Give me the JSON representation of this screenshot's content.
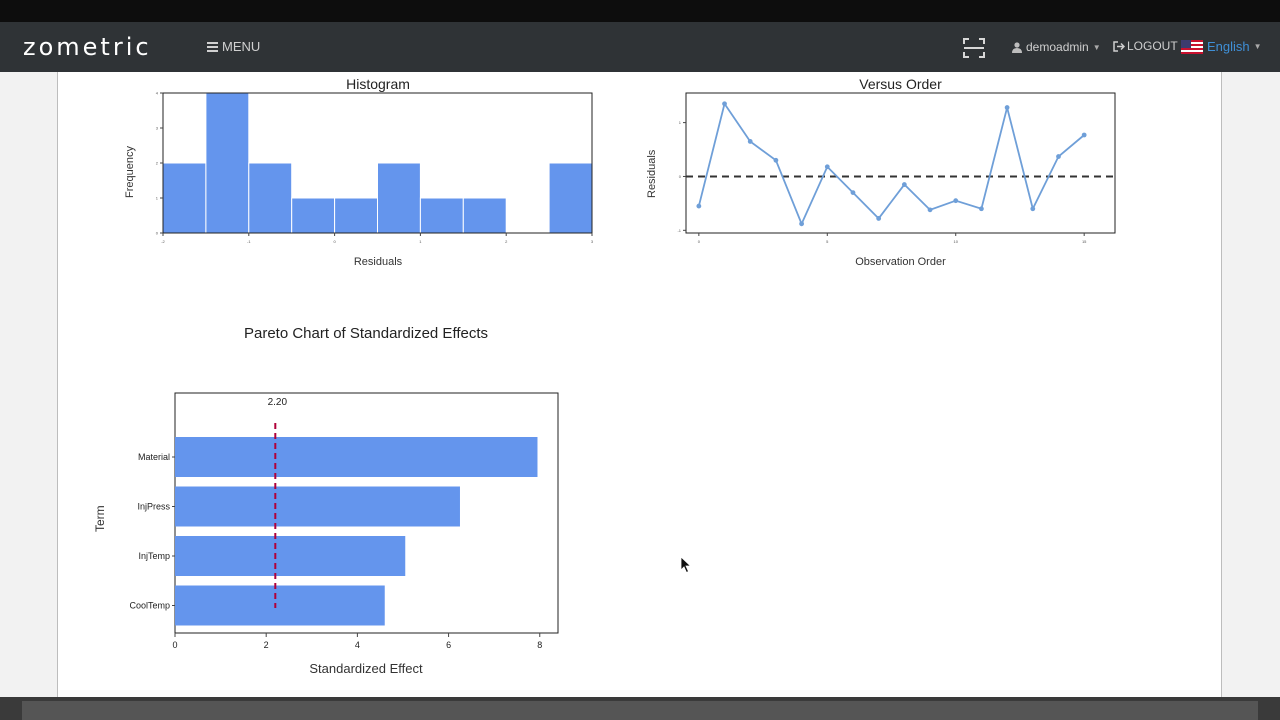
{
  "navbar": {
    "brand": "zometric",
    "menu_label": "MENU",
    "user_label": "demoadmin",
    "logout_label": "LOGOUT",
    "language_label": "English"
  },
  "icons": [
    "hamburger-icon",
    "scan-icon",
    "user-icon",
    "logout-icon",
    "us-flag-icon",
    "chevron-down-icon",
    "mouse-cursor-icon"
  ],
  "colors": {
    "navbar_bg": "#2f3336",
    "bar_fill": "#6495ed",
    "line_color": "#6f9fd8",
    "reference_line": "#b0003a",
    "language_link": "#3f8fd6"
  },
  "histogram": {
    "title": "Histogram",
    "xlabel": "Residuals",
    "ylabel": "Frequency"
  },
  "versus_order": {
    "title": "Versus Order",
    "xlabel": "Observation Order",
    "ylabel": "Residuals"
  },
  "pareto": {
    "title": "Pareto Chart of Standardized Effects",
    "xlabel": "Standardized Effect",
    "ylabel": "Term",
    "reference_label": "2.20"
  },
  "chart_data": [
    {
      "type": "bar",
      "title": "Histogram",
      "xlabel": "Residuals",
      "ylabel": "Frequency",
      "bin_edges": [
        -2,
        -1.5,
        -1,
        -0.5,
        0,
        0.5,
        1,
        1.5,
        2,
        2.5,
        3
      ],
      "values": [
        2,
        4,
        2,
        1,
        1,
        2,
        1,
        1,
        0,
        2
      ],
      "xlim": [
        -2,
        3
      ],
      "ylim": [
        0,
        4
      ],
      "x_ticks": [
        "-2",
        "-1",
        "0",
        "1",
        "2",
        "3"
      ],
      "y_ticks": [
        "0",
        "1",
        "2",
        "3",
        "4"
      ]
    },
    {
      "type": "line",
      "title": "Versus Order",
      "xlabel": "Observation Order",
      "ylabel": "Residuals",
      "x": [
        0,
        1,
        2,
        3,
        4,
        5,
        6,
        7,
        8,
        9,
        10,
        11,
        12,
        13,
        14,
        15
      ],
      "y": [
        -0.55,
        1.35,
        0.65,
        0.3,
        -0.88,
        0.18,
        -0.3,
        -0.78,
        -0.15,
        -0.62,
        -0.45,
        -0.6,
        1.28,
        -0.6,
        0.37,
        0.77
      ],
      "reference_y": 0,
      "xlim": [
        -0.5,
        16.2
      ],
      "ylim": [
        -1.05,
        1.55
      ],
      "x_ticks": [
        "0",
        "5",
        "10",
        "15"
      ],
      "y_ticks": [
        "-1",
        "0",
        "1"
      ]
    },
    {
      "type": "bar",
      "orientation": "horizontal",
      "title": "Pareto Chart of Standardized Effects",
      "xlabel": "Standardized Effect",
      "ylabel": "Term",
      "categories": [
        "Material",
        "InjPress",
        "InjTemp",
        "CoolTemp"
      ],
      "values": [
        7.95,
        6.25,
        5.05,
        4.6
      ],
      "reference_value": 2.2,
      "reference_label": "2.20",
      "xlim": [
        0,
        8.4
      ],
      "x_ticks": [
        "0",
        "2",
        "4",
        "6",
        "8"
      ]
    }
  ]
}
